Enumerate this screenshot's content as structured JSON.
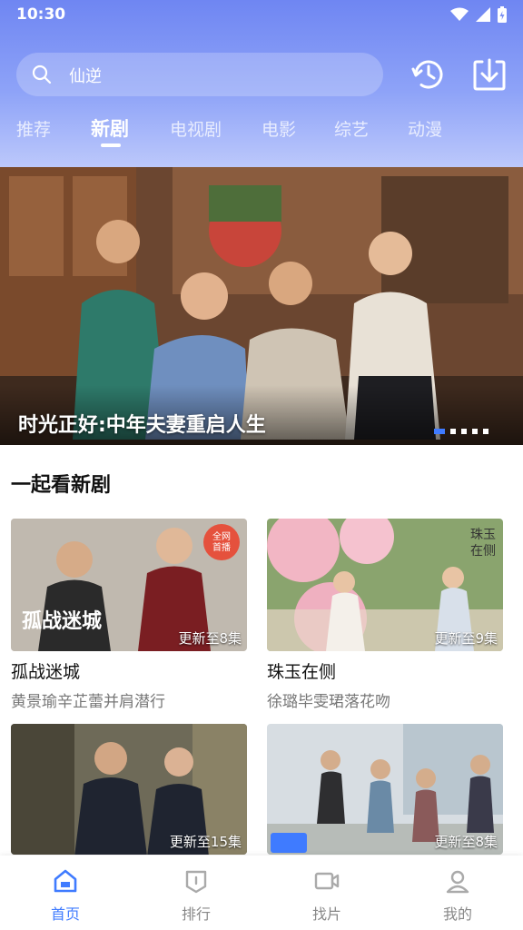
{
  "status_bar": {
    "time": "10:30"
  },
  "search": {
    "query": "仙逆"
  },
  "tabs": [
    {
      "label": "推荐"
    },
    {
      "label": "新剧"
    },
    {
      "label": "电视剧"
    },
    {
      "label": "电影"
    },
    {
      "label": "综艺"
    },
    {
      "label": "动漫"
    }
  ],
  "active_tab": "新剧",
  "banner": {
    "title": "时光正好:中年夫妻重启人生",
    "page_count": 5,
    "active_index": 0
  },
  "section": {
    "title": "一起看新剧"
  },
  "cards": [
    {
      "title": "孤战迷城",
      "subtitle": "黄景瑜辛芷蕾并肩潜行",
      "badge": "更新至8集",
      "poster_text": "孤战迷城",
      "corner_tag": "全网首播"
    },
    {
      "title": "珠玉在侧",
      "subtitle": "徐璐毕雯珺落花吻",
      "badge": "更新至9集",
      "poster_text": "珠玉在侧"
    },
    {
      "badge": "更新至15集"
    },
    {
      "badge": "更新至8集"
    }
  ],
  "bottom_nav": [
    {
      "label": "首页",
      "icon": "home-icon"
    },
    {
      "label": "排行",
      "icon": "ranking-icon"
    },
    {
      "label": "找片",
      "icon": "video-camera-icon"
    },
    {
      "label": "我的",
      "icon": "user-icon"
    }
  ],
  "colors": {
    "accent": "#3f7bff",
    "header_start": "#6f86f2",
    "header_end": "#bcc8fb"
  }
}
